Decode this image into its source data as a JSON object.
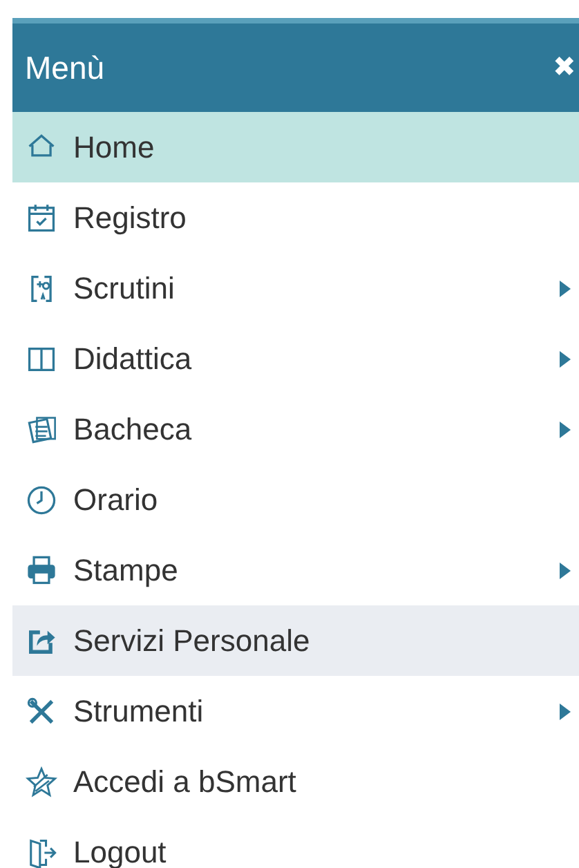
{
  "menu": {
    "title": "Menù",
    "close": "✖"
  },
  "items": [
    {
      "label": "Home",
      "submenu": false,
      "selected": true,
      "highlighted": false
    },
    {
      "label": "Registro",
      "submenu": false,
      "selected": false,
      "highlighted": false
    },
    {
      "label": "Scrutini",
      "submenu": true,
      "selected": false,
      "highlighted": false
    },
    {
      "label": "Didattica",
      "submenu": true,
      "selected": false,
      "highlighted": false
    },
    {
      "label": "Bacheca",
      "submenu": true,
      "selected": false,
      "highlighted": false
    },
    {
      "label": "Orario",
      "submenu": false,
      "selected": false,
      "highlighted": false
    },
    {
      "label": "Stampe",
      "submenu": true,
      "selected": false,
      "highlighted": false
    },
    {
      "label": "Servizi Personale",
      "submenu": false,
      "selected": false,
      "highlighted": true
    },
    {
      "label": "Strumenti",
      "submenu": true,
      "selected": false,
      "highlighted": false
    },
    {
      "label": "Accedi a bSmart",
      "submenu": false,
      "selected": false,
      "highlighted": false
    },
    {
      "label": "Logout",
      "submenu": false,
      "selected": false,
      "highlighted": false
    }
  ]
}
